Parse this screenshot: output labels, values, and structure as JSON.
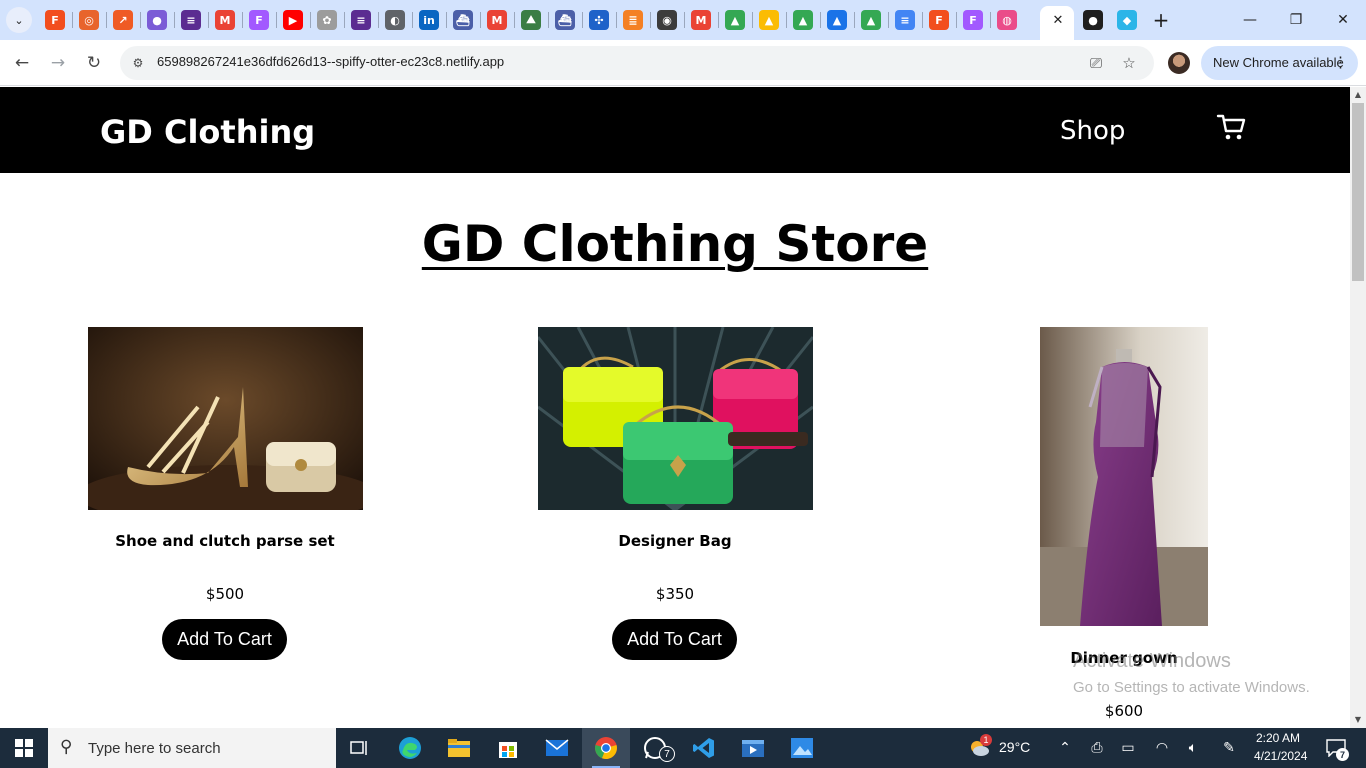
{
  "browser": {
    "tab_search_icon": "chevron-down-icon",
    "tab_favicons": [
      {
        "icon": "figma",
        "color": "#f24e1e",
        "glyph": "F"
      },
      {
        "icon": "target",
        "color": "#e8642c",
        "glyph": "◎"
      },
      {
        "icon": "postman",
        "color": "#ef5b25",
        "glyph": "↗"
      },
      {
        "icon": "loom",
        "color": "#7b5cd6",
        "glyph": "●"
      },
      {
        "icon": "notes",
        "color": "#5b2c91",
        "glyph": "≡"
      },
      {
        "icon": "gmail",
        "color": "#ea4335",
        "glyph": "M"
      },
      {
        "icon": "figma",
        "color": "#a259ff",
        "glyph": "F"
      },
      {
        "icon": "youtube",
        "color": "#ff0000",
        "glyph": "▶"
      },
      {
        "icon": "dribbble-like",
        "color": "#9c9c9c",
        "glyph": "✿"
      },
      {
        "icon": "notes",
        "color": "#5b2c91",
        "glyph": "≡"
      },
      {
        "icon": "globe",
        "color": "#5f6368",
        "glyph": "◐"
      },
      {
        "icon": "linkedin",
        "color": "#0a66c2",
        "glyph": "in"
      },
      {
        "icon": "ship",
        "color": "#4b5fa8",
        "glyph": "⛴"
      },
      {
        "icon": "gmail",
        "color": "#ea4335",
        "glyph": "M"
      },
      {
        "icon": "mountain",
        "color": "#3a7d44",
        "glyph": "⛰"
      },
      {
        "icon": "ship",
        "color": "#4b5fa8",
        "glyph": "⛴"
      },
      {
        "icon": "puzzle",
        "color": "#1e62c9",
        "glyph": "✣"
      },
      {
        "icon": "stackoverflow",
        "color": "#f48024",
        "glyph": "≣"
      },
      {
        "icon": "chrome-mono",
        "color": "#3c3c3c",
        "glyph": "◉"
      },
      {
        "icon": "gmail",
        "color": "#ea4335",
        "glyph": "M"
      },
      {
        "icon": "drive",
        "color": "#34a853",
        "glyph": "▲"
      },
      {
        "icon": "drive",
        "color": "#fbbc04",
        "glyph": "▲"
      },
      {
        "icon": "drive",
        "color": "#34a853",
        "glyph": "▲"
      },
      {
        "icon": "drive",
        "color": "#1a73e8",
        "glyph": "▲"
      },
      {
        "icon": "drive",
        "color": "#34a853",
        "glyph": "▲"
      },
      {
        "icon": "docs",
        "color": "#4285f4",
        "glyph": "≡"
      },
      {
        "icon": "figma",
        "color": "#f24e1e",
        "glyph": "F"
      },
      {
        "icon": "figma",
        "color": "#a259ff",
        "glyph": "F"
      },
      {
        "icon": "dribbble",
        "color": "#ea4c89",
        "glyph": "◍"
      }
    ],
    "after_active_favicons": [
      {
        "icon": "github",
        "color": "#1f1f1f",
        "glyph": "●"
      },
      {
        "icon": "cube",
        "color": "#2bb5e8",
        "glyph": "◆"
      }
    ],
    "active_tab_close": "✕",
    "new_tab": "+",
    "url": "659898267241e36dfd626d13--spiffy-otter-ec23c8.netlify.app",
    "update_label": "New Chrome available"
  },
  "header": {
    "brand": "GD Clothing",
    "nav_shop": "Shop"
  },
  "page_title": "GD Clothing Store",
  "products": [
    {
      "name": "Shoe and clutch parse set",
      "price": "$500",
      "button": "Add To Cart"
    },
    {
      "name": "Designer Bag",
      "price": "$350",
      "button": "Add To Cart"
    },
    {
      "name": "Dinner gown",
      "price": "$600"
    }
  ],
  "watermark": {
    "title": "Activate Windows",
    "subtitle": "Go to Settings to activate Windows."
  },
  "taskbar": {
    "search_placeholder": "Type here to search",
    "weather": "29°C",
    "weather_badge": "1",
    "time": "2:20 AM",
    "date": "4/21/2024",
    "notification_count": "7",
    "whatsapp_badge": "7"
  },
  "colors": {
    "header_bg": "#000000",
    "button_bg": "#000000",
    "tabstrip_bg": "#d3e3fd",
    "taskbar_bg": "#1c2c3c"
  }
}
